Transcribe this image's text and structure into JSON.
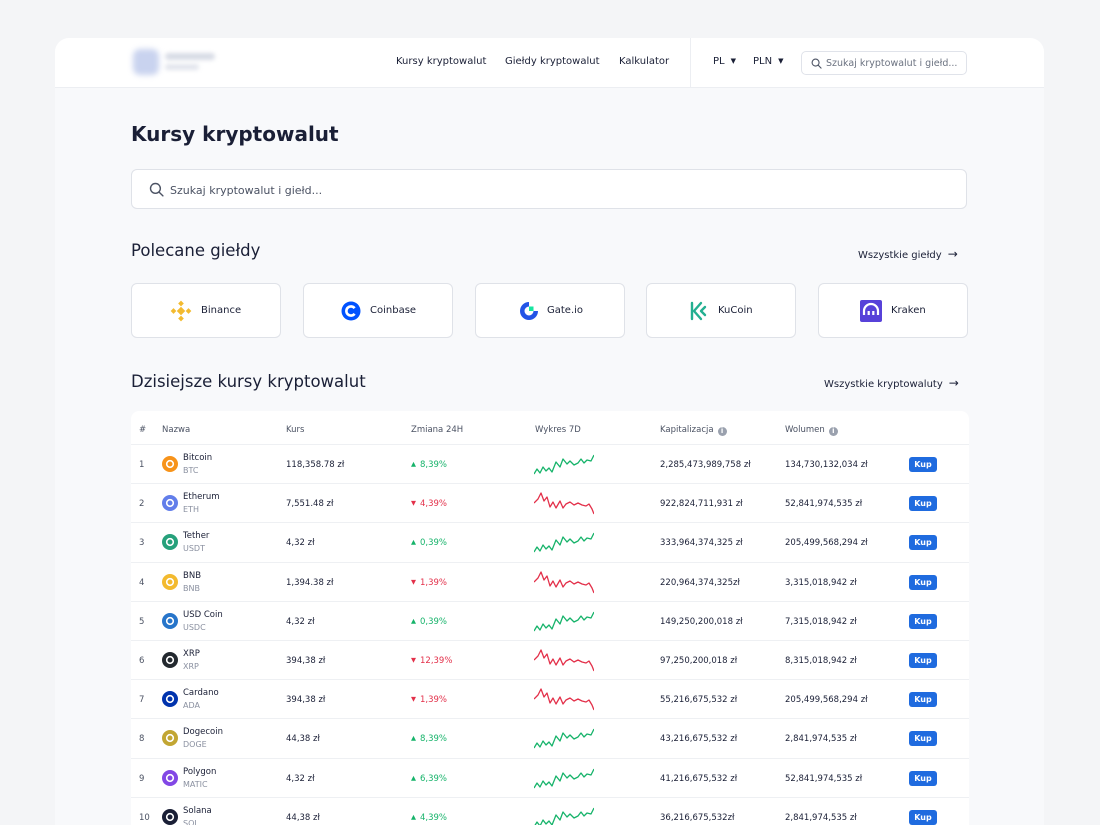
{
  "header": {
    "nav": [
      "Kursy kryptowalut",
      "Giełdy kryptowalut",
      "Kalkulator"
    ],
    "language": "PL",
    "currency": "PLN",
    "search_placeholder": "Szukaj kryptowalut i giełd..."
  },
  "page": {
    "title": "Kursy kryptowalut",
    "search_placeholder": "Szukaj kryptowalut i giełd..."
  },
  "exchanges_section": {
    "title": "Polecane giełdy",
    "see_all": "Wszystkie giełdy",
    "items": [
      {
        "name": "Binance",
        "icon": "binance-icon",
        "color": "#f3ba2f"
      },
      {
        "name": "Coinbase",
        "icon": "coinbase-icon",
        "color": "#0052ff"
      },
      {
        "name": "Gate.io",
        "icon": "gateio-icon",
        "color": "#2354e6"
      },
      {
        "name": "KuCoin",
        "icon": "kucoin-icon",
        "color": "#23af91"
      },
      {
        "name": "Kraken",
        "icon": "kraken-icon",
        "color": "#5741d9"
      }
    ]
  },
  "rates_section": {
    "title": "Dzisiejsze kursy kryptowalut",
    "see_all": "Wszystkie kryptowaluty",
    "columns": [
      "#",
      "Nazwa",
      "Kurs",
      "Zmiana 24H",
      "Wykres 7D",
      "Kapitalizacja",
      "Wolumen"
    ],
    "buy_label": "Kup",
    "colors": {
      "up": "#16b36a",
      "down": "#e3304a",
      "buy": "#1f6bdf"
    },
    "rows": [
      {
        "rank": "1",
        "name": "Bitcoin",
        "symbol": "BTC",
        "icon": "bitcoin-icon",
        "color": "#f7931a",
        "price": "118,358.78 zł",
        "change": "8,39%",
        "trend": "up",
        "cap": "2,285,473,989,758 zł",
        "volume": "134,730,132,034 zł"
      },
      {
        "rank": "2",
        "name": "Etherum",
        "symbol": "ETH",
        "icon": "ethereum-icon",
        "color": "#627eea",
        "price": "7,551.48 zł",
        "change": "4,39%",
        "trend": "down",
        "cap": "922,824,711,931 zł",
        "volume": "52,841,974,535 zł"
      },
      {
        "rank": "3",
        "name": "Tether",
        "symbol": "USDT",
        "icon": "tether-icon",
        "color": "#26a17b",
        "price": "4,32 zł",
        "change": "0,39%",
        "trend": "up",
        "cap": "333,964,374,325 zł",
        "volume": "205,499,568,294 zł"
      },
      {
        "rank": "4",
        "name": "BNB",
        "symbol": "BNB",
        "icon": "bnb-icon",
        "color": "#f3ba2f",
        "price": "1,394.38 zł",
        "change": "1,39%",
        "trend": "down",
        "cap": "220,964,374,325zł",
        "volume": "3,315,018,942 zł"
      },
      {
        "rank": "5",
        "name": "USD Coin",
        "symbol": "USDC",
        "icon": "usdcoin-icon",
        "color": "#2775ca",
        "price": "4,32 zł",
        "change": "0,39%",
        "trend": "up",
        "cap": "149,250,200,018 zł",
        "volume": "7,315,018,942 zł"
      },
      {
        "rank": "6",
        "name": "XRP",
        "symbol": "XRP",
        "icon": "xrp-icon",
        "color": "#23292f",
        "price": "394,38 zł",
        "change": "12,39%",
        "trend": "down",
        "cap": "97,250,200,018 zł",
        "volume": "8,315,018,942 zł"
      },
      {
        "rank": "7",
        "name": "Cardano",
        "symbol": "ADA",
        "icon": "cardano-icon",
        "color": "#0033ad",
        "price": "394,38 zł",
        "change": "1,39%",
        "trend": "down",
        "cap": "55,216,675,532 zł",
        "volume": "205,499,568,294 zł"
      },
      {
        "rank": "8",
        "name": "Dogecoin",
        "symbol": "DOGE",
        "icon": "dogecoin-icon",
        "color": "#c2a633",
        "price": "44,38 zł",
        "change": "8,39%",
        "trend": "up",
        "cap": "43,216,675,532 zł",
        "volume": "2,841,974,535 zł"
      },
      {
        "rank": "9",
        "name": "Polygon",
        "symbol": "MATIC",
        "icon": "polygon-icon",
        "color": "#8247e5",
        "price": "4,32 zł",
        "change": "6,39%",
        "trend": "up",
        "cap": "41,216,675,532 zł",
        "volume": "52,841,974,535 zł"
      },
      {
        "rank": "10",
        "name": "Solana",
        "symbol": "SOL",
        "icon": "solana-icon",
        "color": "#1a1f36",
        "price": "44,38 zł",
        "change": "4,39%",
        "trend": "up",
        "cap": "36,216,675,532zł",
        "volume": "2,841,974,535 zł"
      }
    ]
  }
}
